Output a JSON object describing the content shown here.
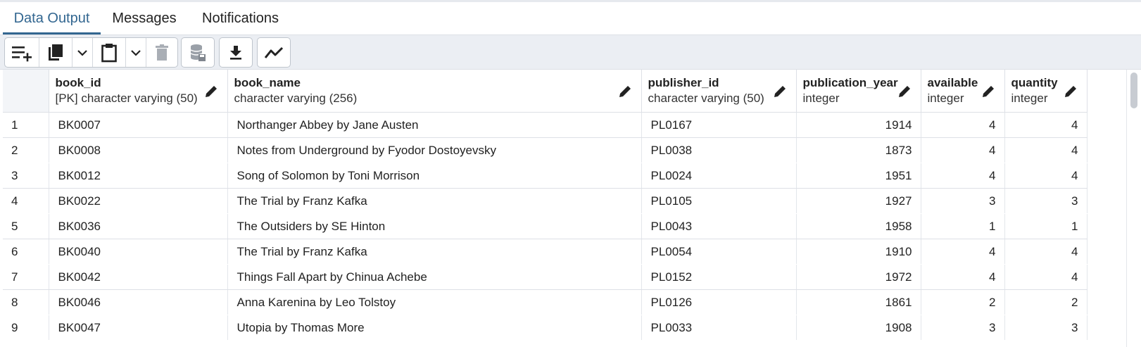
{
  "tabs": [
    {
      "label": "Data Output",
      "active": true
    },
    {
      "label": "Messages",
      "active": false
    },
    {
      "label": "Notifications",
      "active": false
    }
  ],
  "toolbar": {
    "icons": [
      "add-row-icon",
      "copy-icon",
      "chevron-down-icon",
      "paste-icon",
      "chevron-down-icon",
      "delete-icon",
      "save-data-icon",
      "download-icon",
      "graph-visualiser-icon"
    ]
  },
  "table": {
    "columns": [
      {
        "name": "book_id",
        "type": "[PK] character varying (50)"
      },
      {
        "name": "book_name",
        "type": "character varying (256)"
      },
      {
        "name": "publisher_id",
        "type": "character varying (50)"
      },
      {
        "name": "publication_year",
        "type": "integer"
      },
      {
        "name": "available",
        "type": "integer"
      },
      {
        "name": "quantity",
        "type": "integer"
      }
    ],
    "rows": [
      {
        "n": "1",
        "book_id": "BK0007",
        "book_name": "Northanger Abbey by Jane Austen",
        "publisher_id": "PL0167",
        "publication_year": "1914",
        "available": "4",
        "quantity": "4"
      },
      {
        "n": "2",
        "book_id": "BK0008",
        "book_name": "Notes from Underground by Fyodor Dostoyevsky",
        "publisher_id": "PL0038",
        "publication_year": "1873",
        "available": "4",
        "quantity": "4"
      },
      {
        "n": "3",
        "book_id": "BK0012",
        "book_name": "Song of Solomon by Toni Morrison",
        "publisher_id": "PL0024",
        "publication_year": "1951",
        "available": "4",
        "quantity": "4"
      },
      {
        "n": "4",
        "book_id": "BK0022",
        "book_name": "The Trial by Franz Kafka",
        "publisher_id": "PL0105",
        "publication_year": "1927",
        "available": "3",
        "quantity": "3"
      },
      {
        "n": "5",
        "book_id": "BK0036",
        "book_name": "The Outsiders by SE Hinton",
        "publisher_id": "PL0043",
        "publication_year": "1958",
        "available": "1",
        "quantity": "1"
      },
      {
        "n": "6",
        "book_id": "BK0040",
        "book_name": "The Trial by Franz Kafka",
        "publisher_id": "PL0054",
        "publication_year": "1910",
        "available": "4",
        "quantity": "4"
      },
      {
        "n": "7",
        "book_id": "BK0042",
        "book_name": "Things Fall Apart by Chinua Achebe",
        "publisher_id": "PL0152",
        "publication_year": "1972",
        "available": "4",
        "quantity": "4"
      },
      {
        "n": "8",
        "book_id": "BK0046",
        "book_name": "Anna Karenina by Leo Tolstoy",
        "publisher_id": "PL0126",
        "publication_year": "1861",
        "available": "2",
        "quantity": "2"
      },
      {
        "n": "9",
        "book_id": "BK0047",
        "book_name": "Utopia by Thomas More",
        "publisher_id": "PL0033",
        "publication_year": "1908",
        "available": "3",
        "quantity": "3"
      }
    ]
  },
  "colors": {
    "accent": "#326690",
    "toolbar_bg": "#ebeef3",
    "border": "#dde0e6"
  }
}
